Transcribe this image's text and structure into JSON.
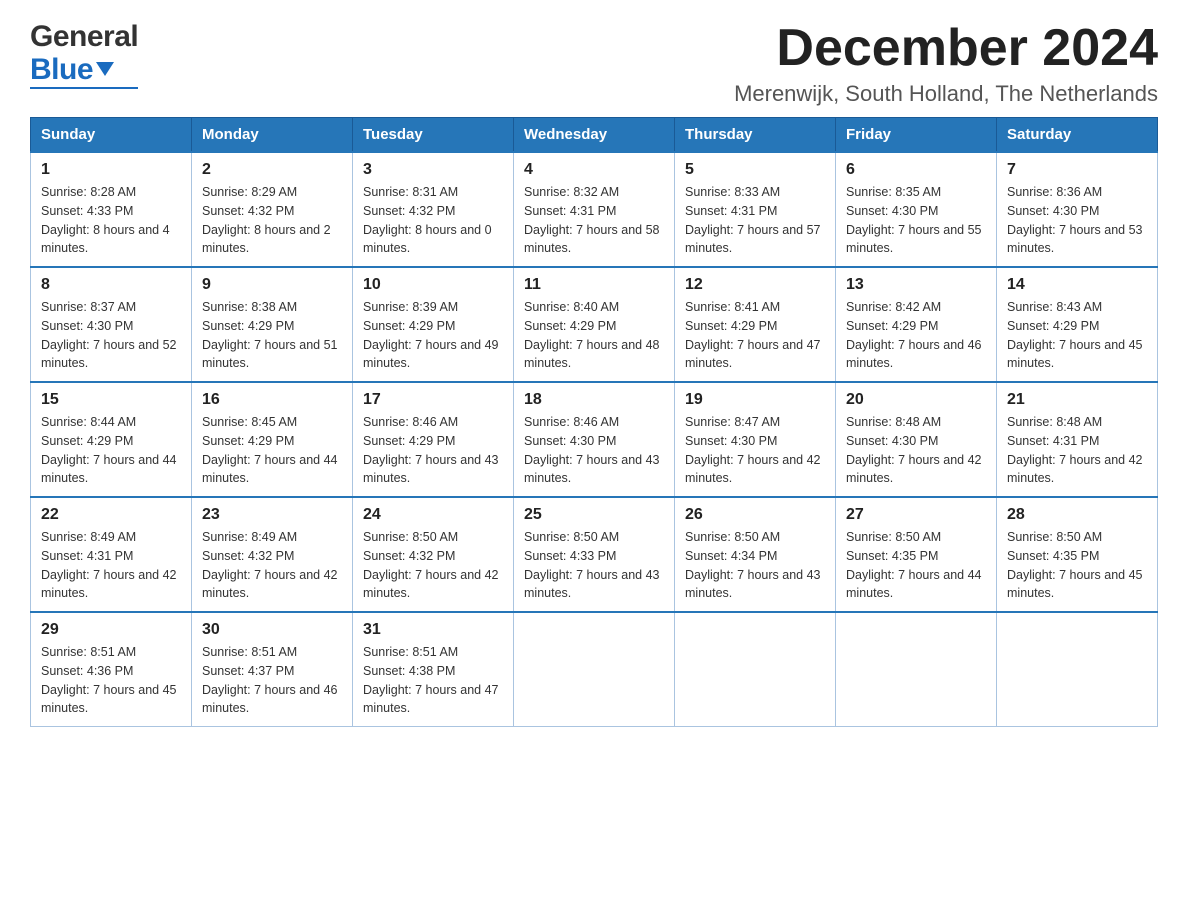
{
  "header": {
    "logo_general": "General",
    "logo_blue": "Blue",
    "month_title": "December 2024",
    "location": "Merenwijk, South Holland, The Netherlands"
  },
  "days_of_week": [
    "Sunday",
    "Monday",
    "Tuesday",
    "Wednesday",
    "Thursday",
    "Friday",
    "Saturday"
  ],
  "weeks": [
    [
      {
        "day": "1",
        "sunrise": "8:28 AM",
        "sunset": "4:33 PM",
        "daylight": "8 hours and 4 minutes."
      },
      {
        "day": "2",
        "sunrise": "8:29 AM",
        "sunset": "4:32 PM",
        "daylight": "8 hours and 2 minutes."
      },
      {
        "day": "3",
        "sunrise": "8:31 AM",
        "sunset": "4:32 PM",
        "daylight": "8 hours and 0 minutes."
      },
      {
        "day": "4",
        "sunrise": "8:32 AM",
        "sunset": "4:31 PM",
        "daylight": "7 hours and 58 minutes."
      },
      {
        "day": "5",
        "sunrise": "8:33 AM",
        "sunset": "4:31 PM",
        "daylight": "7 hours and 57 minutes."
      },
      {
        "day": "6",
        "sunrise": "8:35 AM",
        "sunset": "4:30 PM",
        "daylight": "7 hours and 55 minutes."
      },
      {
        "day": "7",
        "sunrise": "8:36 AM",
        "sunset": "4:30 PM",
        "daylight": "7 hours and 53 minutes."
      }
    ],
    [
      {
        "day": "8",
        "sunrise": "8:37 AM",
        "sunset": "4:30 PM",
        "daylight": "7 hours and 52 minutes."
      },
      {
        "day": "9",
        "sunrise": "8:38 AM",
        "sunset": "4:29 PM",
        "daylight": "7 hours and 51 minutes."
      },
      {
        "day": "10",
        "sunrise": "8:39 AM",
        "sunset": "4:29 PM",
        "daylight": "7 hours and 49 minutes."
      },
      {
        "day": "11",
        "sunrise": "8:40 AM",
        "sunset": "4:29 PM",
        "daylight": "7 hours and 48 minutes."
      },
      {
        "day": "12",
        "sunrise": "8:41 AM",
        "sunset": "4:29 PM",
        "daylight": "7 hours and 47 minutes."
      },
      {
        "day": "13",
        "sunrise": "8:42 AM",
        "sunset": "4:29 PM",
        "daylight": "7 hours and 46 minutes."
      },
      {
        "day": "14",
        "sunrise": "8:43 AM",
        "sunset": "4:29 PM",
        "daylight": "7 hours and 45 minutes."
      }
    ],
    [
      {
        "day": "15",
        "sunrise": "8:44 AM",
        "sunset": "4:29 PM",
        "daylight": "7 hours and 44 minutes."
      },
      {
        "day": "16",
        "sunrise": "8:45 AM",
        "sunset": "4:29 PM",
        "daylight": "7 hours and 44 minutes."
      },
      {
        "day": "17",
        "sunrise": "8:46 AM",
        "sunset": "4:29 PM",
        "daylight": "7 hours and 43 minutes."
      },
      {
        "day": "18",
        "sunrise": "8:46 AM",
        "sunset": "4:30 PM",
        "daylight": "7 hours and 43 minutes."
      },
      {
        "day": "19",
        "sunrise": "8:47 AM",
        "sunset": "4:30 PM",
        "daylight": "7 hours and 42 minutes."
      },
      {
        "day": "20",
        "sunrise": "8:48 AM",
        "sunset": "4:30 PM",
        "daylight": "7 hours and 42 minutes."
      },
      {
        "day": "21",
        "sunrise": "8:48 AM",
        "sunset": "4:31 PM",
        "daylight": "7 hours and 42 minutes."
      }
    ],
    [
      {
        "day": "22",
        "sunrise": "8:49 AM",
        "sunset": "4:31 PM",
        "daylight": "7 hours and 42 minutes."
      },
      {
        "day": "23",
        "sunrise": "8:49 AM",
        "sunset": "4:32 PM",
        "daylight": "7 hours and 42 minutes."
      },
      {
        "day": "24",
        "sunrise": "8:50 AM",
        "sunset": "4:32 PM",
        "daylight": "7 hours and 42 minutes."
      },
      {
        "day": "25",
        "sunrise": "8:50 AM",
        "sunset": "4:33 PM",
        "daylight": "7 hours and 43 minutes."
      },
      {
        "day": "26",
        "sunrise": "8:50 AM",
        "sunset": "4:34 PM",
        "daylight": "7 hours and 43 minutes."
      },
      {
        "day": "27",
        "sunrise": "8:50 AM",
        "sunset": "4:35 PM",
        "daylight": "7 hours and 44 minutes."
      },
      {
        "day": "28",
        "sunrise": "8:50 AM",
        "sunset": "4:35 PM",
        "daylight": "7 hours and 45 minutes."
      }
    ],
    [
      {
        "day": "29",
        "sunrise": "8:51 AM",
        "sunset": "4:36 PM",
        "daylight": "7 hours and 45 minutes."
      },
      {
        "day": "30",
        "sunrise": "8:51 AM",
        "sunset": "4:37 PM",
        "daylight": "7 hours and 46 minutes."
      },
      {
        "day": "31",
        "sunrise": "8:51 AM",
        "sunset": "4:38 PM",
        "daylight": "7 hours and 47 minutes."
      },
      null,
      null,
      null,
      null
    ]
  ],
  "labels": {
    "sunrise": "Sunrise:",
    "sunset": "Sunset:",
    "daylight": "Daylight:"
  }
}
